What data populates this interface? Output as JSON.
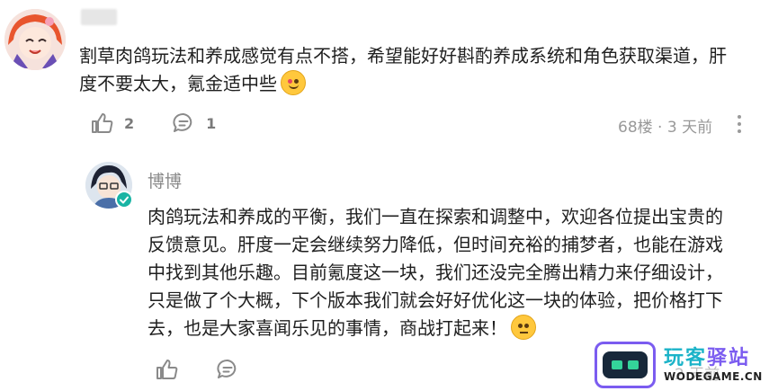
{
  "comment1": {
    "username": "",
    "lines": [
      "割草肉鸽玩法和养成感觉有点不搭，希望能好好斟酌养成系统和角色获取渠道，肝",
      "度不要太大，氪金适中些"
    ],
    "emoji": "grinning-heart-emoji",
    "likes": "2",
    "replies": "1",
    "floor": "68楼",
    "separator": "·",
    "time": "3 天前"
  },
  "comment2": {
    "username": "博博",
    "lines": [
      "肉鸽玩法和养成的平衡，我们一直在探索和调整中，欢迎各位提出宝贵的",
      "反馈意见。肝度一定会继续努力降低，但时间充裕的捕梦者，也能在游戏",
      "中找到其他乐趣。目前氪度这一块，我们还没完全腾出精力来仔细设计，",
      "只是做了个大概，下个版本我们就会好好优化这一块的体验，把价格打下",
      "去，也是大家喜闻乐见的事情，商战打起来！"
    ],
    "emoji": "smirk-emoji",
    "time": "2 天前"
  },
  "watermark": {
    "title_part1": "玩客",
    "title_part2": "驿站",
    "domain": "WODEGAME.CN"
  },
  "colors": {
    "text": "#1f1f1f",
    "muted": "#999999",
    "verified": "#19b4a4",
    "wm_purple": "#7b5cf0",
    "wm_cyan": "#1bb3c8"
  }
}
